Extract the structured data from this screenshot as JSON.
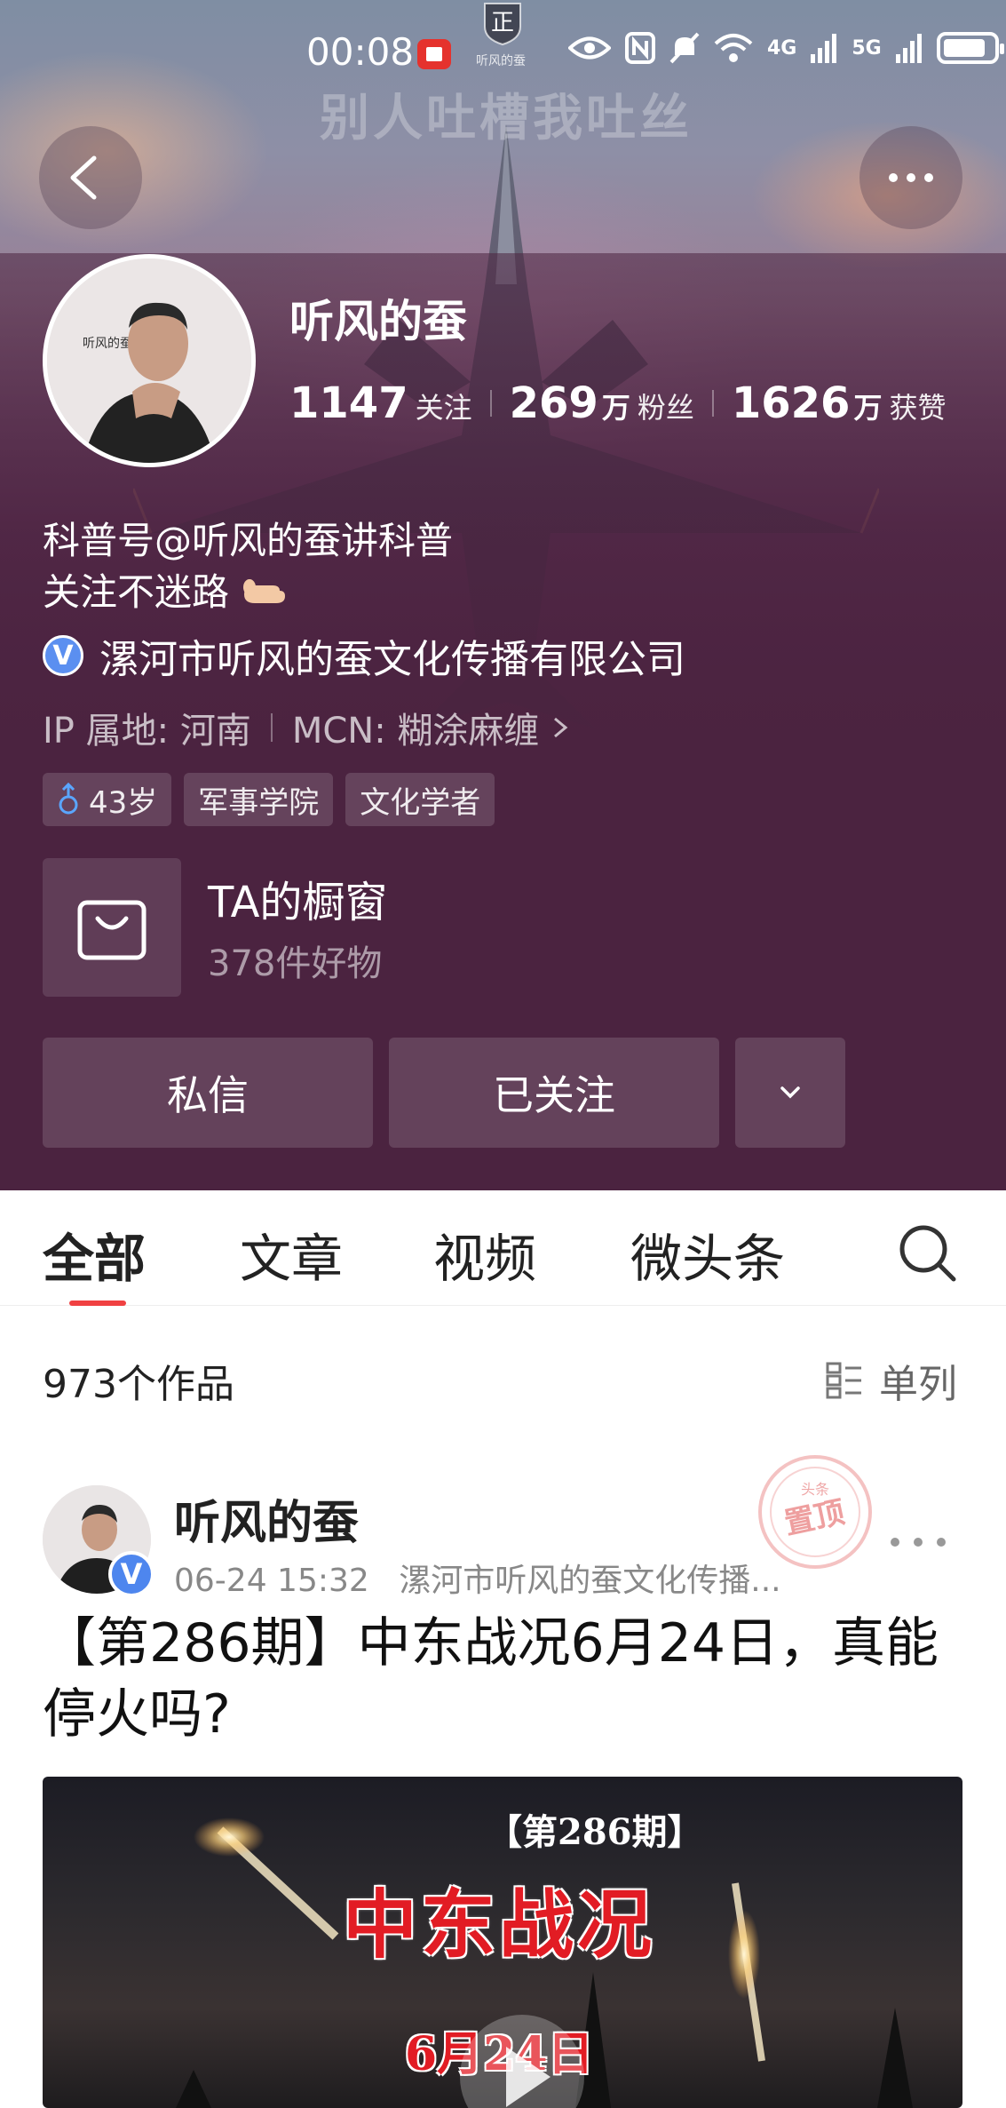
{
  "status_bar": {
    "time": "00:08",
    "network_4g": "4G",
    "network_5g": "5G"
  },
  "cover": {
    "slogan": "别人吐槽我吐丝",
    "logo_char": "正",
    "logo_caption": "听风的蚕"
  },
  "profile": {
    "name": "听风的蚕",
    "avatar_caption": "听风的蚕",
    "stats": [
      {
        "num": "1147",
        "unit": "",
        "label": "关注"
      },
      {
        "num": "269",
        "unit": "万",
        "label": "粉丝"
      },
      {
        "num": "1626",
        "unit": "万",
        "label": "获赞"
      }
    ],
    "bio_line1": "科普号@听风的蚕讲科普",
    "bio_line2": "关注不迷路",
    "verify_badge": "V",
    "verify_text": "漯河市听风的蚕文化传播有限公司",
    "ip_location": "IP 属地: 河南",
    "mcn": "MCN: 糊涂麻缠",
    "tags": [
      "43岁",
      "军事学院",
      "文化学者"
    ],
    "shop_title": "TA的橱窗",
    "shop_sub": "378件好物",
    "message_label": "私信",
    "follow_label": "已关注"
  },
  "tabs": [
    "全部",
    "文章",
    "视频",
    "微头条"
  ],
  "feed": {
    "works_count": "973个作品",
    "view_mode": "单列"
  },
  "post": {
    "author": "听风的蚕",
    "badge": "V",
    "time": "06-24 15:32",
    "source": "漯河市听风的蚕文化传播...",
    "title": "【第286期】中东战况6月24日，真能停火吗?",
    "stamp_top": "头条",
    "stamp_main": "置顶",
    "thumb_issue": "【第286期】",
    "thumb_title": "中东战况",
    "thumb_date": "6月24日"
  },
  "colors": {
    "header_bg": "#4b2340",
    "accent_red": "#f04142",
    "verify_blue": "#5b8ff0"
  },
  "icons": [
    "back-icon",
    "more-icon",
    "shopping-bag-icon",
    "chevron-down-icon",
    "search-icon",
    "list-view-icon",
    "play-icon",
    "male-icon",
    "eye-icon",
    "nfc-icon",
    "mute-icon",
    "wifi-icon",
    "battery-icon"
  ]
}
